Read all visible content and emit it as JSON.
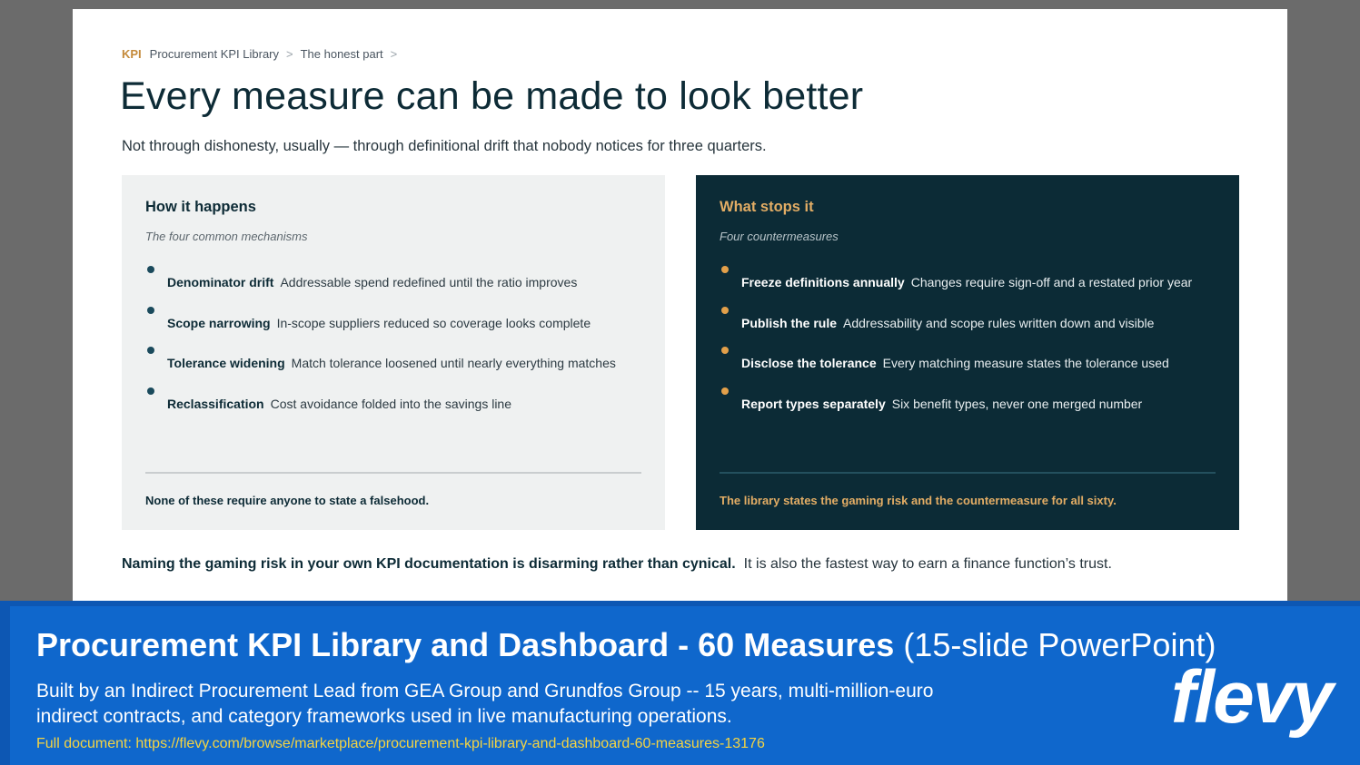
{
  "breadcrumb": {
    "tag": "KPI",
    "items": [
      "Procurement KPI Library",
      "The honest part"
    ],
    "separator": ">"
  },
  "title": "Every measure can be made to look better",
  "subtitle": "Not through dishonesty, usually — through definitional drift that nobody notices for three quarters.",
  "left_card": {
    "heading": "How it happens",
    "subheading": "The four common mechanisms",
    "items": [
      {
        "term": "Denominator drift",
        "desc": "Addressable spend redefined until the ratio improves"
      },
      {
        "term": "Scope narrowing",
        "desc": "In-scope suppliers reduced so coverage looks complete"
      },
      {
        "term": "Tolerance widening",
        "desc": "Match tolerance loosened until nearly everything matches"
      },
      {
        "term": "Reclassification",
        "desc": "Cost avoidance folded into the savings line"
      }
    ],
    "footer": "None of these require anyone to state a falsehood."
  },
  "right_card": {
    "heading": "What stops it",
    "subheading": "Four countermeasures",
    "items": [
      {
        "term": "Freeze definitions annually",
        "desc": "Changes require sign-off and a restated prior year"
      },
      {
        "term": "Publish the rule",
        "desc": "Addressability and scope rules written down and visible"
      },
      {
        "term": "Disclose the tolerance",
        "desc": "Every matching measure states the tolerance used"
      },
      {
        "term": "Report types separately",
        "desc": "Six benefit types, never one merged number"
      }
    ],
    "footer": "The library states the gaming risk and the countermeasure for all sixty."
  },
  "closing": {
    "strong": "Naming the gaming risk in your own KPI documentation is disarming rather than cynical.",
    "rest": "It is also the fastest way to earn a finance function’s trust."
  },
  "banner": {
    "title_bold": "Procurement KPI Library and Dashboard - 60 Measures",
    "title_light": "(15-slide PowerPoint)",
    "description": "Built by an Indirect Procurement Lead from GEA Group and Grundfos Group -- 15 years, multi-million-euro indirect contracts, and category frameworks used in live manufacturing operations.",
    "link": "Full document: https://flevy.com/browse/marketplace/procurement-kpi-library-and-dashboard-60-measures-13176",
    "logo": "flevy"
  },
  "colors": {
    "accent": "#c48a3a",
    "dark_teal": "#0c2b36",
    "banner_blue": "#0f67cc",
    "link_yellow": "#f5d442"
  }
}
